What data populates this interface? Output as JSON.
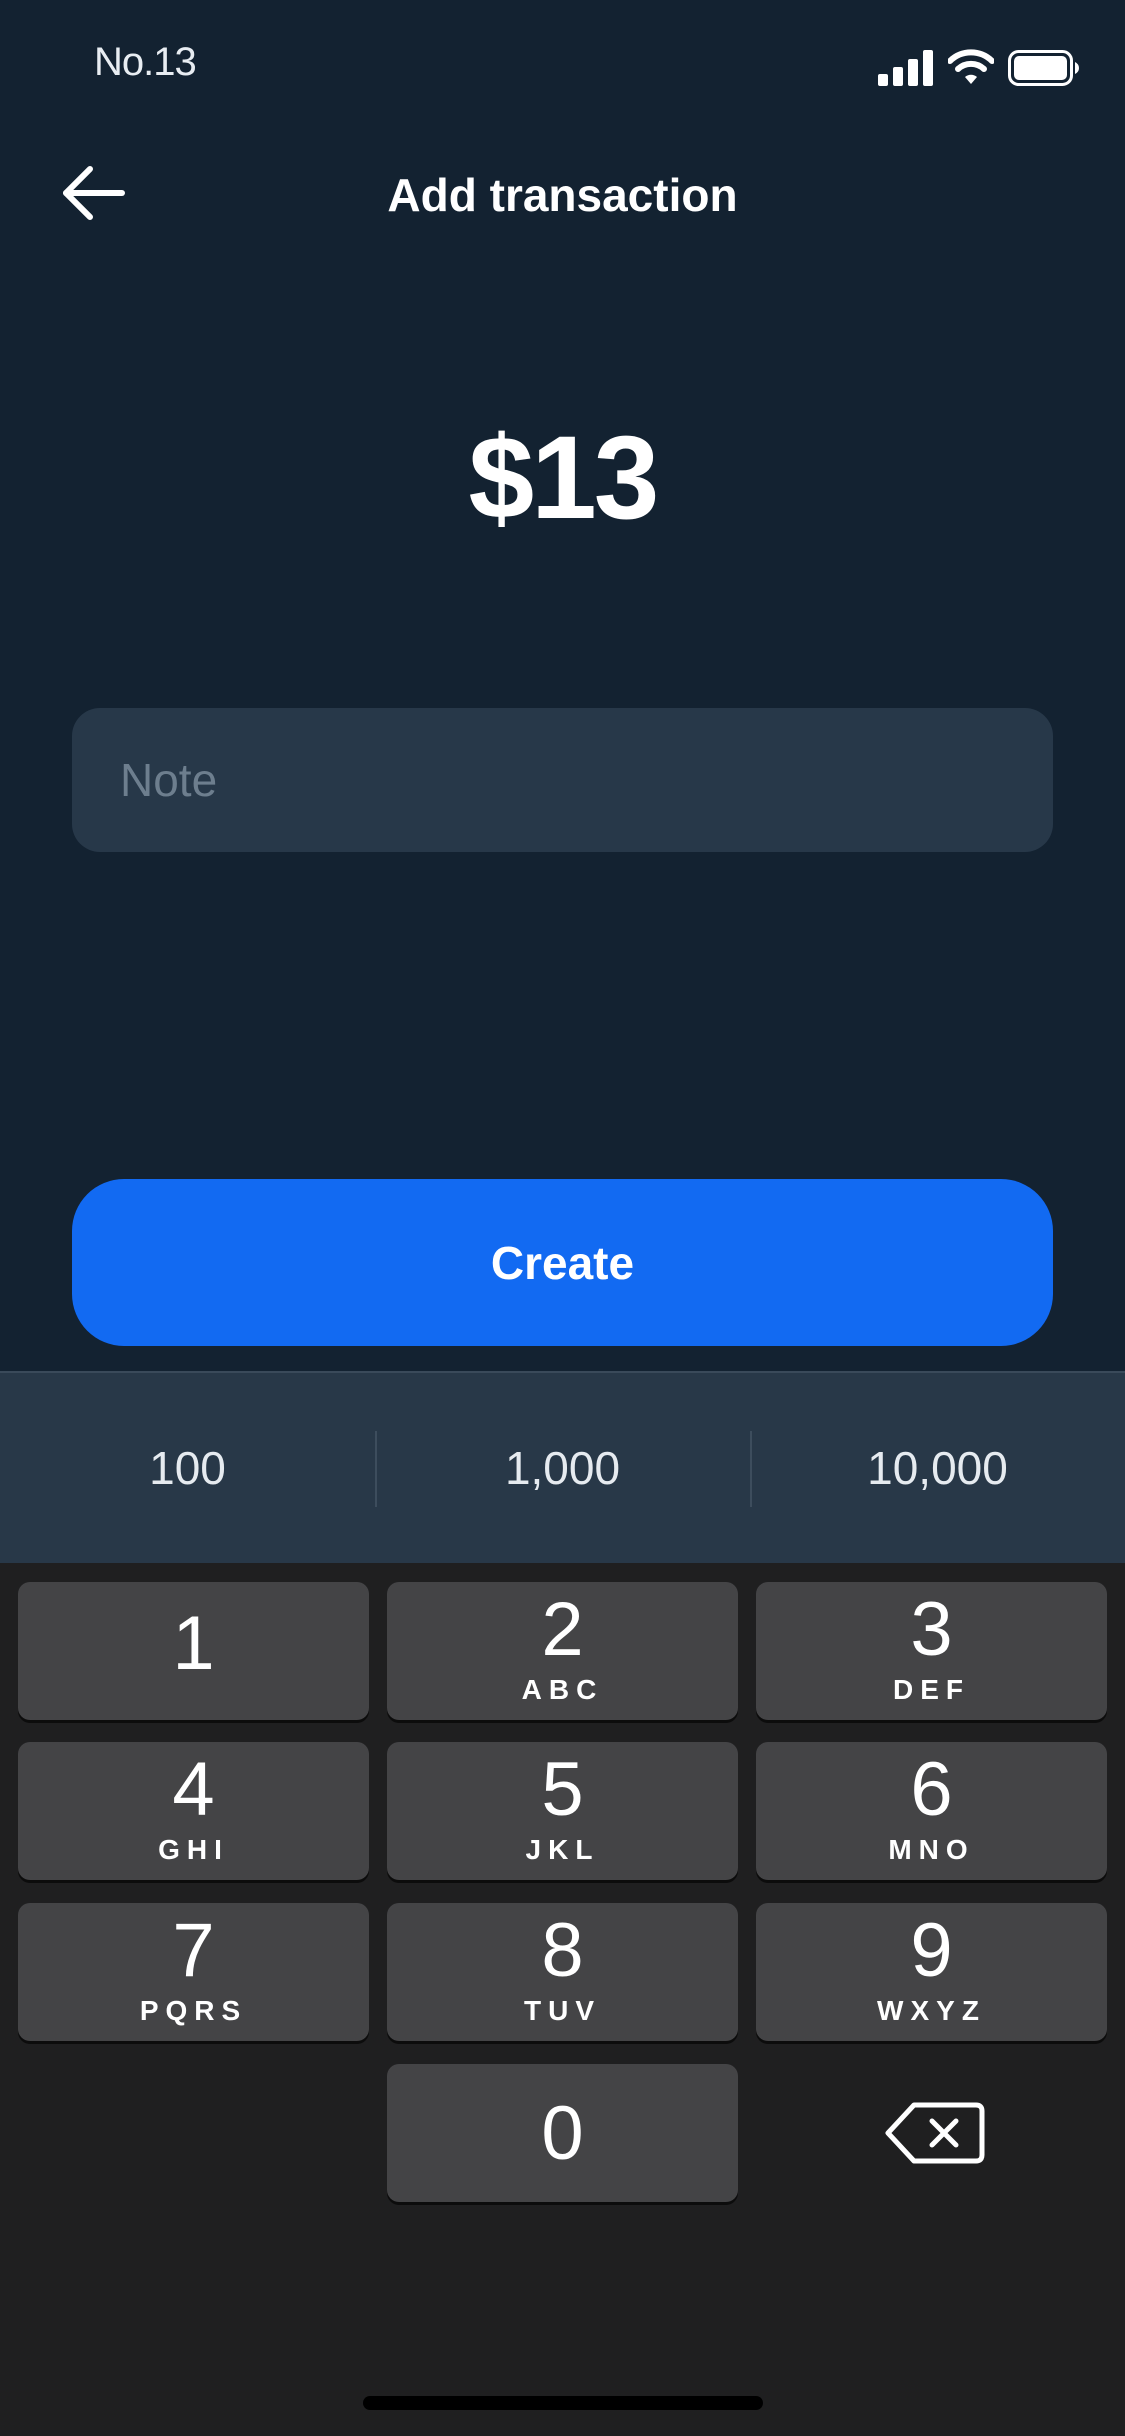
{
  "status_bar": {
    "time": "No.13",
    "icons": [
      "signal-icon",
      "wifi-icon",
      "battery-icon"
    ]
  },
  "header": {
    "back_icon": "arrow-left-icon",
    "title": "Add transaction"
  },
  "amount": "$13",
  "note": {
    "placeholder": "Note",
    "value": ""
  },
  "create_label": "Create",
  "quick_amounts": [
    "100",
    "1,000",
    "10,000"
  ],
  "keypad": {
    "keys": [
      {
        "digit": "1",
        "letters": ""
      },
      {
        "digit": "2",
        "letters": "ABC"
      },
      {
        "digit": "3",
        "letters": "DEF"
      },
      {
        "digit": "4",
        "letters": "GHI"
      },
      {
        "digit": "5",
        "letters": "JKL"
      },
      {
        "digit": "6",
        "letters": "MNO"
      },
      {
        "digit": "7",
        "letters": "PQRS"
      },
      {
        "digit": "8",
        "letters": "TUV"
      },
      {
        "digit": "9",
        "letters": "WXYZ"
      },
      {
        "digit": "0",
        "letters": ""
      }
    ],
    "delete_icon": "backspace-icon"
  },
  "colors": {
    "background": "#132231",
    "note_field": "#273849",
    "create_button": "#126af2",
    "quick_bar": "#283848",
    "keypad_background": "#1f1f20",
    "key": "#444446"
  }
}
